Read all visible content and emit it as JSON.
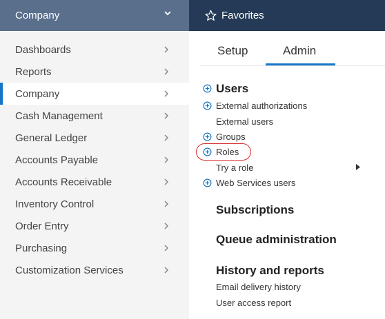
{
  "header": {
    "module_title": "Company",
    "favorites_label": "Favorites"
  },
  "sidebar": {
    "items": [
      {
        "label": "Dashboards",
        "active": false
      },
      {
        "label": "Reports",
        "active": false
      },
      {
        "label": "Company",
        "active": true
      },
      {
        "label": "Cash Management",
        "active": false
      },
      {
        "label": "General Ledger",
        "active": false
      },
      {
        "label": "Accounts Payable",
        "active": false
      },
      {
        "label": "Accounts Receivable",
        "active": false
      },
      {
        "label": "Inventory Control",
        "active": false
      },
      {
        "label": "Order Entry",
        "active": false
      },
      {
        "label": "Purchasing",
        "active": false
      },
      {
        "label": "Customization Services",
        "active": false
      }
    ]
  },
  "tabs": [
    {
      "label": "Setup",
      "active": false
    },
    {
      "label": "Admin",
      "active": true
    }
  ],
  "admin": {
    "users_heading": "Users",
    "users_links": [
      {
        "label": "External authorizations",
        "icon": "plus-circle-icon"
      },
      {
        "label": "External users",
        "icon": ""
      },
      {
        "label": "Groups",
        "icon": "plus-circle-icon"
      },
      {
        "label": "Roles",
        "icon": "plus-circle-icon",
        "highlighted": true
      },
      {
        "label": "Try a role",
        "icon": "",
        "submenu": true
      },
      {
        "label": "Web Services users",
        "icon": "plus-circle-icon"
      }
    ],
    "subscriptions_heading": "Subscriptions",
    "queue_heading": "Queue administration",
    "history_heading": "History and reports",
    "history_links": [
      {
        "label": "Email delivery history"
      },
      {
        "label": "User access report"
      }
    ]
  },
  "colors": {
    "header_left": "#5a6f8c",
    "header_right": "#243a56",
    "accent": "#1576c9",
    "highlight": "#d42b2b",
    "sidebar_bg": "#f4f4f4"
  }
}
